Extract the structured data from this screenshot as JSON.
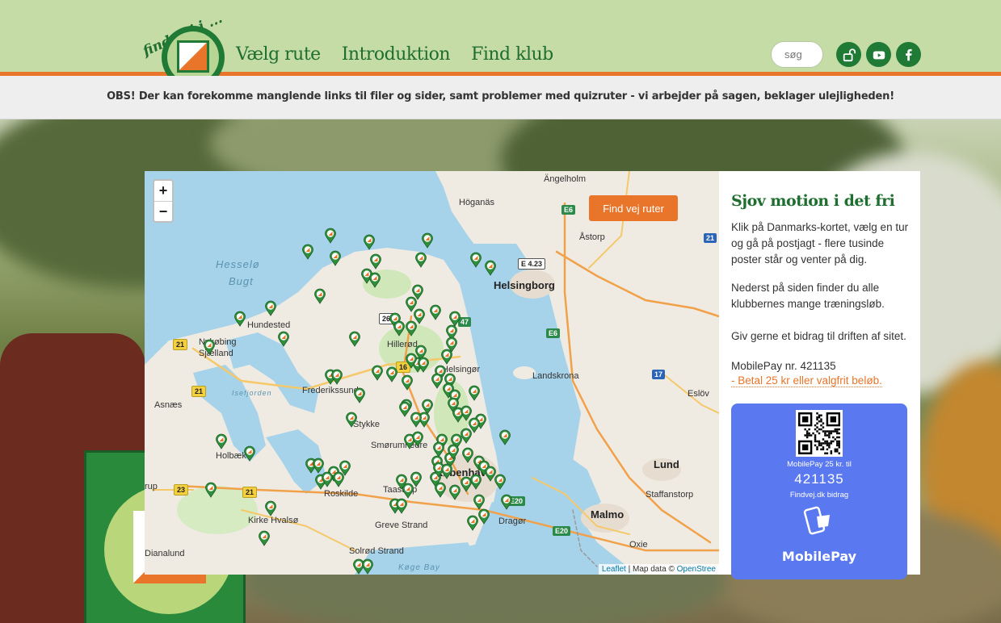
{
  "logo": {
    "script_text": "find vej i ..."
  },
  "nav": {
    "items": [
      "Vælg rute",
      "Introduktion",
      "Find klub"
    ]
  },
  "search": {
    "placeholder": "søg"
  },
  "notice": "OBS! Der kan forekomme manglende links til filer og sider, samt problemer med quizruter - vi arbejder på sagen, beklager ulejligheden!",
  "icons": [
    "lock-open-icon",
    "youtube-icon",
    "facebook-icon"
  ],
  "map": {
    "find_button": "Find vej ruter",
    "zoom_in": "+",
    "zoom_out": "−",
    "attribution_link": "Leaflet",
    "attribution_text": "| Map data ©",
    "attribution_osm": "OpenStree",
    "places": {
      "aengelholm": "Ängelholm",
      "hoganas": "Höganäs",
      "astorp": "Åstorp",
      "hesselo": "Hesselø",
      "bugt": "Bugt",
      "helsingborg": "Helsingborg",
      "hundested": "Hundested",
      "nykobing": "Nykøbing",
      "sjaelland": "Sjælland",
      "hillerod": "Hillerød",
      "landskrona": "Landskrona",
      "helsingor": "Helsingør",
      "frederikssund": "Frederikssund",
      "eslov": "Eslöv",
      "asnaes": "Asnæs",
      "isefjorden": "Isefjorden",
      "stykke": "Stykke",
      "smorum": "Smørumnedre",
      "holbaek": "Holbæk",
      "kobenhavn": "København",
      "lund": "Lund",
      "roskilde": "Roskilde",
      "taastrup": "Taastrup",
      "staffanstorp": "Staffanstorp",
      "kirke_hvalso": "Kirke Hvalsø",
      "greve": "Greve Strand",
      "dragor": "Dragør",
      "malmo": "Malmo",
      "oxie": "Oxie",
      "dianalund": "Dianalund",
      "solrod": "Solrød Strand",
      "koge_bay": "Køge Bay",
      "trup": "rup"
    },
    "roads": {
      "e6a": "E6",
      "e6b": "E6",
      "e423": "E 4.23",
      "r21a": "21",
      "r21b": "21",
      "r21c": "21",
      "r21d": "21",
      "r267": "267",
      "r47": "47",
      "r16": "16",
      "r17": "17",
      "r23": "23",
      "e20a": "E20",
      "e20b": "E20"
    }
  },
  "panel": {
    "title": "Sjov motion i det fri",
    "intro": "Klik på Danmarks-kortet, vælg en tur og gå på postjagt - flere tusinde poster står og venter på dig.",
    "clubs": "Nederst på siden finder du alle klubbernes mange træningsløb.",
    "donate": "Giv gerne et bidrag til driften af sitet.",
    "mobilepay_nr": "MobilePay nr. 421135",
    "pay_link": "- Betal 25 kr eller valgfrit beløb.",
    "card": {
      "line1": "MobilePay 25 kr. til",
      "number": "421135",
      "line2": "Findvej.dk bidrag",
      "brand": "MobilePay"
    }
  },
  "colors": {
    "green": "#1e7a34",
    "orange": "#e8752a",
    "header_bg": "#c6dca6",
    "mobilepay": "#5a78f0"
  }
}
